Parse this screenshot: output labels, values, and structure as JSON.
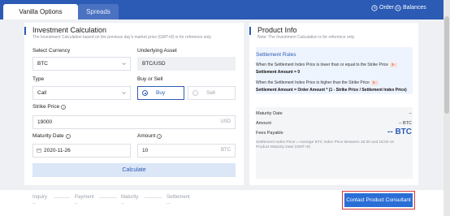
{
  "tabs": [
    {
      "label": "Vanilla Options",
      "active": true
    },
    {
      "label": "Spreads",
      "active": false
    }
  ],
  "top_links": {
    "order": "Order",
    "balances": "Balances"
  },
  "calc": {
    "title": "Investment Calculation",
    "note": "The Investment Calculation based on the previous day's market price (GMT+8) is for reference only.",
    "select_currency_label": "Select Currency",
    "currency_value": "BTC",
    "underlying_label": "Underlying Asset",
    "underlying_value": "BTC/USD",
    "type_label": "Type",
    "type_value": "Call",
    "buy_sell_label": "Buy or Sell",
    "buy_label": "Buy",
    "sell_label": "Sell",
    "strike_label": "Strike Price",
    "strike_value": "19000",
    "strike_unit": "USD",
    "maturity_label": "Maturity Date",
    "maturity_value": "2020-11-26",
    "amount_label": "Amount",
    "amount_value": "10",
    "amount_unit": "BTC",
    "calculate_label": "Calculate"
  },
  "product": {
    "title": "Product Info",
    "note": "Note: The Investment Calculation is for reference only.",
    "rules_title": "Settlement Rules",
    "rule1_text": "When the Settlement Index Price is lower than or equal to the Strike Price",
    "rule1_tag": "$--",
    "rule1_formula": "Settlement Amount = 0",
    "rule2_text": "When the Settlement Index Price is higher than the Strike Price",
    "rule2_tag": "$--",
    "rule2_formula": "Settlement Amount = Order Amount * (1 - Strike Price / Settlement Index Price)",
    "maturity_label": "Maturity Date",
    "maturity_value": "--",
    "amount_label": "Amount",
    "amount_value": "-- BTC",
    "fees_label": "Fees Payable",
    "fees_value": "-- BTC",
    "index_note": "Settlement Index Price = Average BTC Index Price Between 15:30 and 16:00 on Product Maturity Date (GMT+8)"
  },
  "steps": [
    {
      "label": "Inquiry",
      "value": "--"
    },
    {
      "label": "Payment",
      "value": "--"
    },
    {
      "label": "Maturity",
      "value": "--"
    },
    {
      "label": "Settlement",
      "value": "--"
    }
  ],
  "contact_label": "Contact Product Consultant",
  "colors": {
    "brand": "#2b5bb5",
    "highlight_outline": "#d23c3c",
    "tag": "#e05a3a"
  }
}
